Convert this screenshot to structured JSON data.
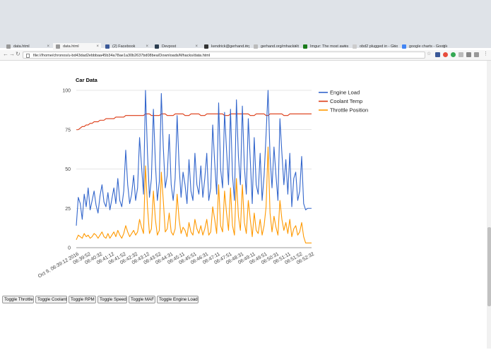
{
  "browser": {
    "tabs": [
      {
        "label": "data.html",
        "active": false
      },
      {
        "label": "data.html",
        "active": true
      },
      {
        "label": "(2) Facebook",
        "active": false
      },
      {
        "label": "Devpost",
        "active": false
      },
      {
        "label": "kendrick@gerhand.org",
        "active": false
      },
      {
        "label": "gerhand.org/mhacks/dat",
        "active": false
      },
      {
        "label": "Imgur: The most aweso",
        "active": false
      },
      {
        "label": "obd2 plugged in - Goog",
        "active": false
      },
      {
        "label": "google charts - Google S",
        "active": false
      }
    ],
    "address": "file:///home/chronos/u-bd43dad2ebbbaa45b34a78ae1a30b2637bd08bea/Downloads/Mhacks/data.html"
  },
  "chart_data": {
    "type": "line",
    "title": "Car Data",
    "xlabel": "",
    "ylabel": "",
    "ylim": [
      0,
      100
    ],
    "yticks": [
      "0",
      "25",
      "50",
      "75",
      "100"
    ],
    "legend_position": "right",
    "grid": true,
    "x_tick_labels": [
      "Oct 9, 06:39:12 2016",
      "06:39:52",
      "06:40:32",
      "06:41:12",
      "06:41:52",
      "06:42:32",
      "06:43:12",
      "06:43:52",
      "06:44:31",
      "06:45:11",
      "06:45:51",
      "06:46:31",
      "06:47:11",
      "06:47:51",
      "06:48:31",
      "06:49:11",
      "06:49:51",
      "06:50:31",
      "06:51:11",
      "06:51:52",
      "06:52:32"
    ],
    "series": [
      {
        "name": "Engine Load",
        "color": "#3366cc",
        "values": [
          14,
          32,
          28,
          18,
          34,
          26,
          38,
          24,
          30,
          36,
          27,
          22,
          33,
          40,
          29,
          26,
          35,
          24,
          31,
          38,
          28,
          44,
          30,
          26,
          36,
          62,
          40,
          28,
          34,
          46,
          30,
          38,
          70,
          52,
          34,
          100,
          60,
          32,
          44,
          88,
          54,
          30,
          42,
          98,
          64,
          38,
          46,
          72,
          40,
          30,
          44,
          84,
          52,
          32,
          48,
          40,
          28,
          56,
          36,
          30,
          60,
          40,
          34,
          52,
          32,
          44,
          60,
          30,
          38,
          78,
          54,
          34,
          92,
          50,
          38,
          86,
          62,
          40,
          88,
          46,
          30,
          94,
          58,
          40,
          90,
          52,
          34,
          82,
          56,
          28,
          70,
          40,
          34,
          60,
          30,
          46,
          72,
          100,
          58,
          38,
          64,
          46,
          30,
          82,
          60,
          40,
          56,
          34,
          60,
          26,
          44,
          48,
          30,
          36,
          58,
          28,
          24,
          25,
          25,
          25
        ]
      },
      {
        "name": "Coolant Temp",
        "color": "#dc3912",
        "values": [
          75,
          75,
          76,
          77,
          77,
          78,
          78,
          79,
          79,
          80,
          80,
          80,
          81,
          81,
          81,
          82,
          82,
          82,
          82,
          82,
          83,
          83,
          83,
          83,
          83,
          84,
          84,
          84,
          84,
          84,
          84,
          84,
          84,
          84,
          84,
          85,
          85,
          85,
          84,
          84,
          84,
          84,
          84,
          85,
          85,
          85,
          84,
          84,
          84,
          84,
          85,
          85,
          85,
          85,
          85,
          84,
          84,
          84,
          85,
          85,
          85,
          85,
          85,
          84,
          84,
          84,
          85,
          85,
          85,
          85,
          85,
          85,
          85,
          85,
          85,
          84,
          84,
          84,
          85,
          85,
          85,
          85,
          85,
          85,
          85,
          85,
          85,
          85,
          84,
          84,
          84,
          85,
          85,
          85,
          85,
          85,
          84,
          84,
          85,
          85,
          85,
          85,
          85,
          85,
          85,
          84,
          84,
          84,
          85,
          85,
          85,
          85,
          85,
          85,
          85,
          85,
          85,
          85,
          85,
          85
        ]
      },
      {
        "name": "Throttle Position",
        "color": "#ff9900",
        "values": [
          5,
          8,
          7,
          6,
          9,
          7,
          8,
          6,
          7,
          9,
          8,
          6,
          8,
          10,
          7,
          6,
          9,
          6,
          8,
          10,
          7,
          11,
          8,
          6,
          9,
          14,
          10,
          7,
          9,
          11,
          8,
          10,
          18,
          13,
          9,
          52,
          26,
          9,
          12,
          36,
          18,
          8,
          11,
          48,
          30,
          10,
          12,
          22,
          10,
          8,
          12,
          34,
          18,
          9,
          13,
          11,
          7,
          16,
          10,
          8,
          18,
          12,
          9,
          14,
          8,
          12,
          18,
          8,
          10,
          26,
          18,
          9,
          40,
          14,
          10,
          36,
          22,
          11,
          38,
          14,
          8,
          44,
          20,
          11,
          40,
          16,
          9,
          30,
          18,
          7,
          22,
          11,
          9,
          18,
          8,
          14,
          26,
          64,
          22,
          10,
          20,
          13,
          8,
          30,
          18,
          11,
          16,
          9,
          18,
          7,
          12,
          14,
          8,
          10,
          16,
          7,
          3,
          3,
          3,
          3
        ]
      }
    ]
  },
  "buttons": {
    "toggle_throttle": "Toggle Throttle",
    "toggle_coolant": "Toggle Coolant",
    "toggle_rpm": "Toggle RPM",
    "toggle_speed": "Toggle Speed",
    "toggle_maf": "Toggle MAF",
    "toggle_engine_load": "Toggle Engine Load"
  }
}
